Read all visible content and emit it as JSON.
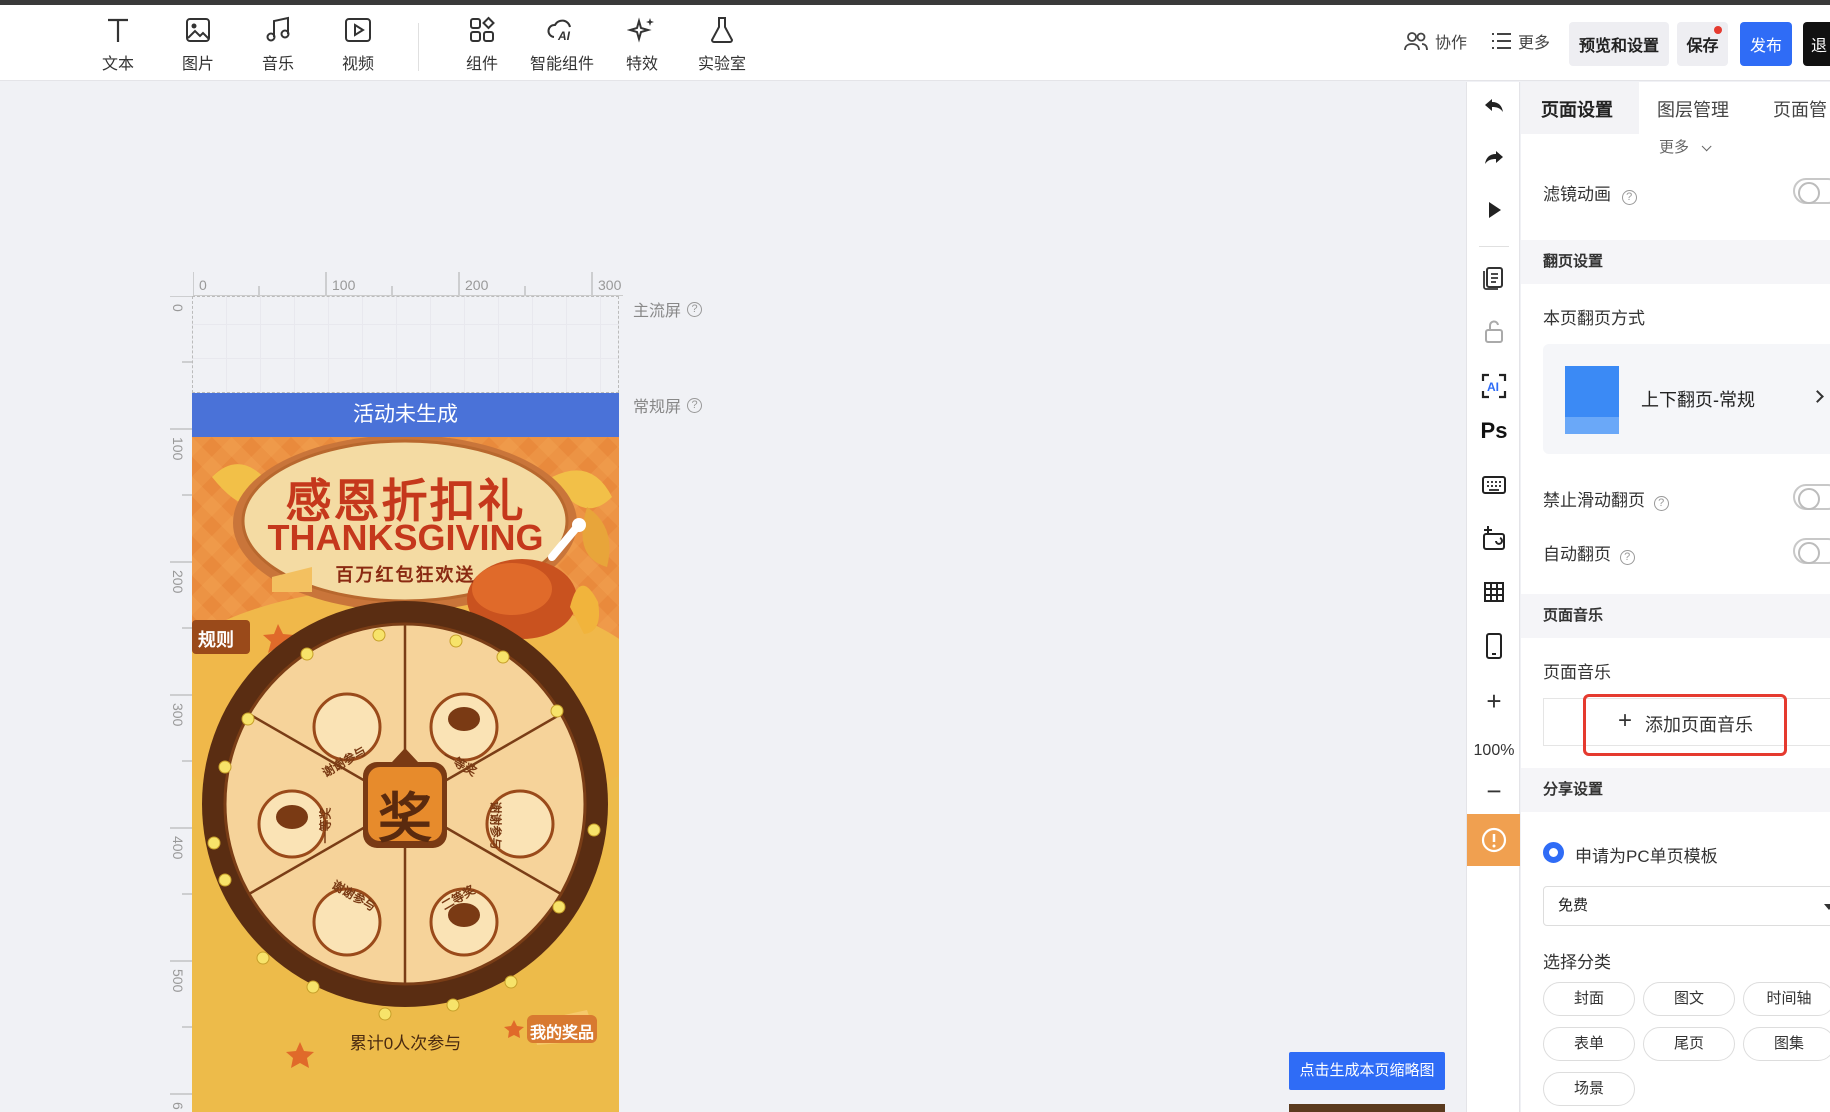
{
  "toolbar": {
    "tools": [
      {
        "label": "文本",
        "icon": "text-icon"
      },
      {
        "label": "图片",
        "icon": "image-icon"
      },
      {
        "label": "音乐",
        "icon": "music-icon"
      },
      {
        "label": "视频",
        "icon": "video-icon"
      },
      {
        "label": "组件",
        "icon": "components-icon"
      },
      {
        "label": "智能组件",
        "icon": "ai-components-icon"
      },
      {
        "label": "特效",
        "icon": "sparkle-icon"
      },
      {
        "label": "实验室",
        "icon": "flask-icon"
      }
    ],
    "collab_label": "协作",
    "more_label": "更多",
    "preview_label": "预览和设置",
    "save_label": "保存",
    "publish_label": "发布",
    "exit_label": "退"
  },
  "canvas": {
    "ruler_h": [
      "0",
      "100",
      "200",
      "300"
    ],
    "ruler_v": [
      "0",
      "100",
      "200",
      "300",
      "400",
      "500",
      "6"
    ],
    "main_screen_label": "主流屏",
    "normal_screen_label": "常规屏",
    "banner_text": "活动未生成",
    "art": {
      "title": "感恩折扣礼",
      "subtitle": "THANKSGIVING",
      "tagline": "百万红包狂欢送",
      "rules_label": "规则",
      "center_label": "奖",
      "prizes_label": "我的奖品",
      "count_text": "累计0人次参与",
      "slices": [
        "谢谢参与",
        "一等奖",
        "谢谢参与",
        "一等奖",
        "谢谢参与",
        "二等奖"
      ]
    },
    "thumb_button": "点击生成本页缩略图"
  },
  "sidebar": {
    "zoom": "100%",
    "icons": [
      "undo-icon",
      "redo-icon",
      "play-icon",
      "pages-icon",
      "lock-icon",
      "ai-icon",
      "ps-icon",
      "keyboard-icon",
      "replace-icon",
      "grid-icon",
      "phone-icon",
      "zoom-in-icon",
      "zoom-out-icon",
      "alert-icon"
    ],
    "ps_text": "Ps",
    "ai_text": "AI"
  },
  "panel": {
    "tabs": [
      "页面设置",
      "图层管理",
      "页面管"
    ],
    "more_label": "更多",
    "filter_anim": "滤镜动画",
    "flip_section": "翻页设置",
    "flip_mode_label": "本页翻页方式",
    "flip_mode_value": "上下翻页-常规",
    "disable_swipe": "禁止滑动翻页",
    "auto_flip": "自动翻页",
    "music_section": "页面音乐",
    "music_label": "页面音乐",
    "add_music": "添加页面音乐",
    "share_section": "分享设置",
    "pc_template": "申请为PC单页模板",
    "price_value": "免费",
    "category_label": "选择分类",
    "categories": [
      "封面",
      "图文",
      "时间轴",
      "表单",
      "尾页",
      "图集",
      "场景"
    ]
  },
  "colors": {
    "accent": "#2f6cf6",
    "banner": "#4a72d8",
    "highlight": "#e53a2f",
    "warn": "#f0a050"
  }
}
